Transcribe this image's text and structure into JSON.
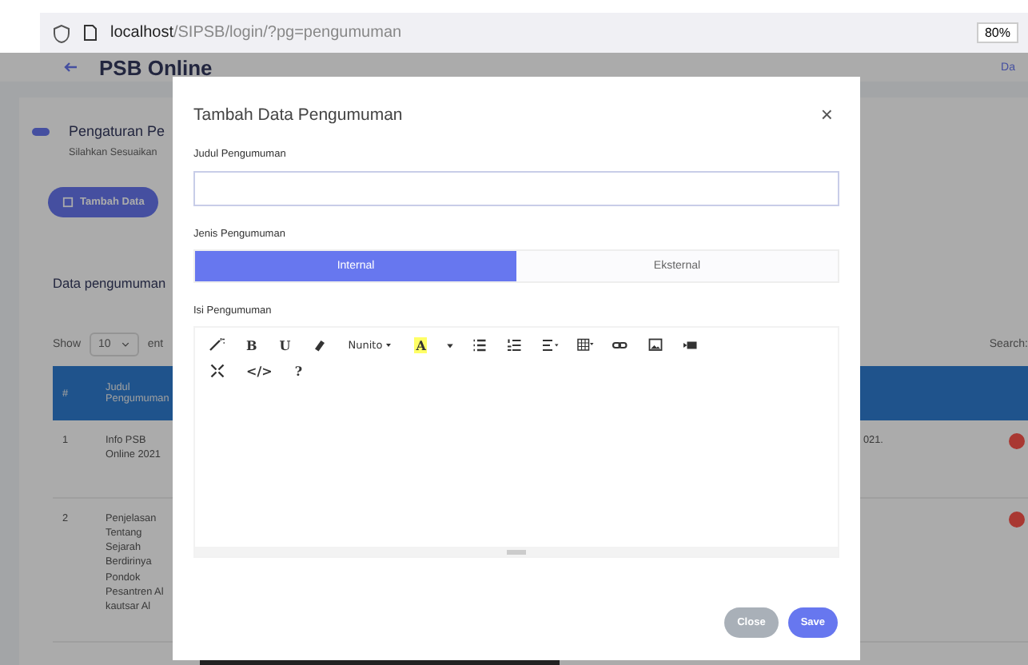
{
  "browser": {
    "url_host": "localhost",
    "url_path": "/SIPSB/login/?pg=pengumuman",
    "zoom": "80%"
  },
  "page": {
    "title": "PSB Online",
    "header_link": "Da",
    "section_title": "Pengaturan Pe",
    "section_subtitle": "Silahkan Sesuaikan",
    "add_button": "Tambah Data",
    "table_title": "Data pengumuman",
    "show_label": "Show",
    "page_size": "10",
    "entries_label": "ent",
    "search_label": "Search:",
    "columns": [
      "#",
      "Judul Pengumuman"
    ],
    "rows": [
      {
        "number": "1",
        "title": "Info PSB Online 2021",
        "column_3": "021."
      },
      {
        "number": "2",
        "title": "Penjelasan Tentang Sejarah Berdirinya Pondok Pesantren Al kautsar Al"
      }
    ]
  },
  "modal": {
    "title": "Tambah Data Pengumuman",
    "close": "×",
    "title_label": "Judul Pengumuman",
    "type_label": "Jenis Pengumuman",
    "type_options": [
      {
        "label": "Internal",
        "selected": true
      },
      {
        "label": "Eksternal",
        "selected": false
      }
    ],
    "content_label": "Isi Pengumuman",
    "toolbar": [
      [
        {
          "kind": "icon"
        },
        {
          "kind": "text",
          "label": "B"
        },
        {
          "kind": "text",
          "label": "U"
        },
        {
          "kind": "icon"
        },
        {
          "kind": "dropdown",
          "label": "Nunito"
        },
        {
          "kind": "highlight",
          "label": "A"
        },
        {
          "kind": "caret"
        },
        {
          "kind": "icon"
        },
        {
          "kind": "icon"
        },
        {
          "kind": "icon"
        },
        {
          "kind": "icon"
        },
        {
          "kind": "icon"
        },
        {
          "kind": "icon"
        },
        {
          "kind": "icon"
        }
      ],
      [
        {
          "kind": "icon"
        },
        {
          "kind": "text",
          "label": "</>"
        },
        {
          "kind": "text",
          "label": "?"
        }
      ]
    ],
    "buttons": [
      {
        "label": "Close",
        "kind": "secondary"
      },
      {
        "label": "Save",
        "kind": "primary"
      }
    ]
  }
}
